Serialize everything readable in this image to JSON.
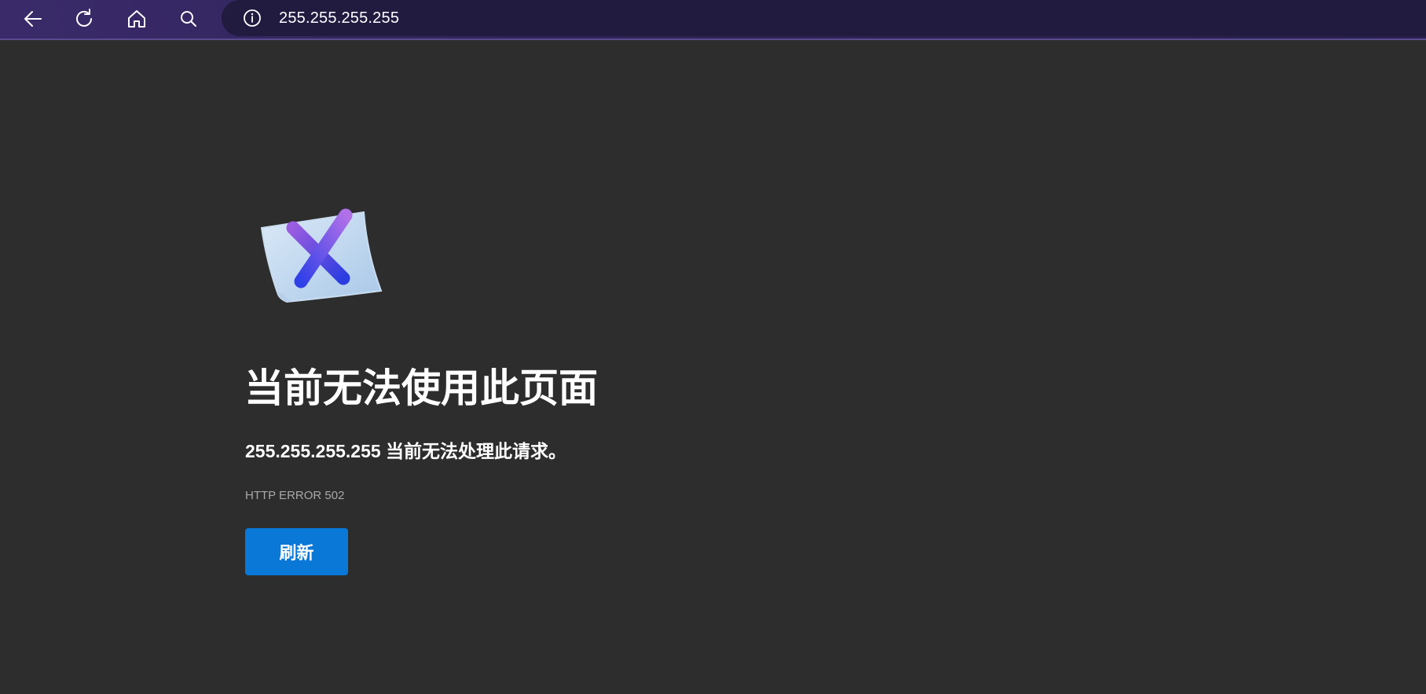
{
  "browser": {
    "address_bar": {
      "url": "255.255.255.255"
    },
    "icons": {
      "back": "back-arrow-icon",
      "refresh": "refresh-icon",
      "home": "home-icon",
      "search": "search-icon",
      "info": "info-icon"
    },
    "colors": {
      "toolbar": "#2e2456",
      "address_bar": "#221b40"
    }
  },
  "error_page": {
    "title": "当前无法使用此页面",
    "message": "255.255.255.255 当前无法处理此请求。",
    "error_code": "HTTP ERROR 502",
    "refresh_label": "刷新",
    "colors": {
      "background": "#2d2d2d",
      "button": "#0a78d7"
    }
  }
}
